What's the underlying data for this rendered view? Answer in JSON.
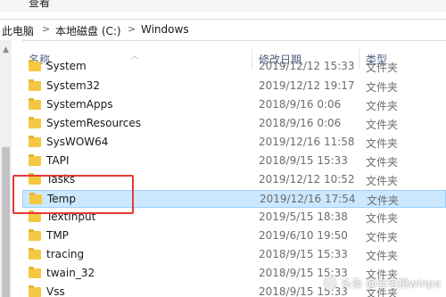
{
  "ribbon": {
    "view_tab": "查看"
  },
  "address_bar": {
    "crumbs": [
      "此电脑",
      "本地磁盘 (C:)",
      "Windows"
    ],
    "separator": ">"
  },
  "columns": {
    "name": "名称",
    "date_modified": "修改日期",
    "type": "类型"
  },
  "files": [
    {
      "name": "System",
      "date": "2019/12/12 15:33",
      "type": "文件夹"
    },
    {
      "name": "System32",
      "date": "2019/12/12 19:17",
      "type": "文件夹"
    },
    {
      "name": "SystemApps",
      "date": "2018/9/16 0:06",
      "type": "文件夹"
    },
    {
      "name": "SystemResources",
      "date": "2018/9/16 0:06",
      "type": "文件夹"
    },
    {
      "name": "SysWOW64",
      "date": "2019/12/16 11:58",
      "type": "文件夹"
    },
    {
      "name": "TAPI",
      "date": "2018/9/15 15:33",
      "type": "文件夹"
    },
    {
      "name": "Tasks",
      "date": "2019/12/12 10:52",
      "type": "文件夹"
    },
    {
      "name": "Temp",
      "date": "2019/12/16 17:54",
      "type": "文件夹",
      "selected": true
    },
    {
      "name": "TextInput",
      "date": "2019/5/15 18:38",
      "type": "文件夹"
    },
    {
      "name": "TMP",
      "date": "2019/6/10 19:50",
      "type": "文件夹"
    },
    {
      "name": "tracing",
      "date": "2018/9/15 15:33",
      "type": "文件夹"
    },
    {
      "name": "twain_32",
      "date": "2018/9/15 15:33",
      "type": "文件夹"
    },
    {
      "name": "Vss",
      "date": "2018/9/15 15:33",
      "type": "文件夹"
    }
  ],
  "watermark": {
    "text": "头条 @老毛桃winpe"
  },
  "colors": {
    "selection": "#cce8ff",
    "highlight_box": "#e53935",
    "folder": "#f5c842"
  }
}
